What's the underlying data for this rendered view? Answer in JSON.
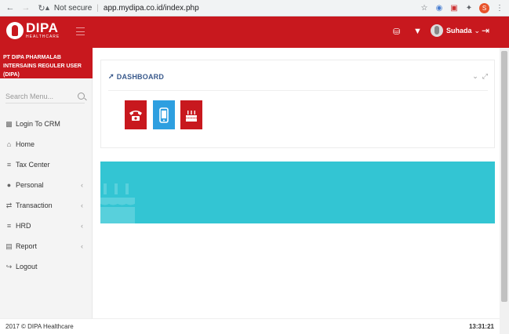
{
  "browser": {
    "security_label": "Not secure",
    "url": "app.mydipa.co.id/index.php",
    "profile_initial": "S"
  },
  "header": {
    "logo_text": "DIPA",
    "logo_subtext": "HEALTHCARE",
    "user_name": "Suhada",
    "brand_color": "#c8181e"
  },
  "sidebar": {
    "company_name": "PT DIPA PHARMALAB INTERSAINS REGULER USER (DIPA)",
    "search_placeholder": "Search Menu...",
    "items": [
      {
        "label": "Login To CRM",
        "icon": "login-crm-icon",
        "has_submenu": false
      },
      {
        "label": "Home",
        "icon": "home-icon",
        "has_submenu": false
      },
      {
        "label": "Tax Center",
        "icon": "list-icon",
        "has_submenu": false
      },
      {
        "label": "Personal",
        "icon": "user-icon",
        "has_submenu": true
      },
      {
        "label": "Transaction",
        "icon": "exchange-icon",
        "has_submenu": true
      },
      {
        "label": "HRD",
        "icon": "list-icon",
        "has_submenu": true
      },
      {
        "label": "Report",
        "icon": "report-icon",
        "has_submenu": true
      },
      {
        "label": "Logout",
        "icon": "logout-icon",
        "has_submenu": false
      }
    ]
  },
  "dashboard": {
    "title": "DASHBOARD",
    "tiles": [
      {
        "icon": "phone-icon",
        "color": "#c8181e"
      },
      {
        "icon": "mobile-icon",
        "color": "#2e9fe0"
      },
      {
        "icon": "birthday-cake-icon",
        "color": "#c8181e"
      }
    ],
    "banner_color": "#33c5d3"
  },
  "footer": {
    "copyright": "2017 © DIPA Healthcare",
    "clock": "13:31:21"
  }
}
